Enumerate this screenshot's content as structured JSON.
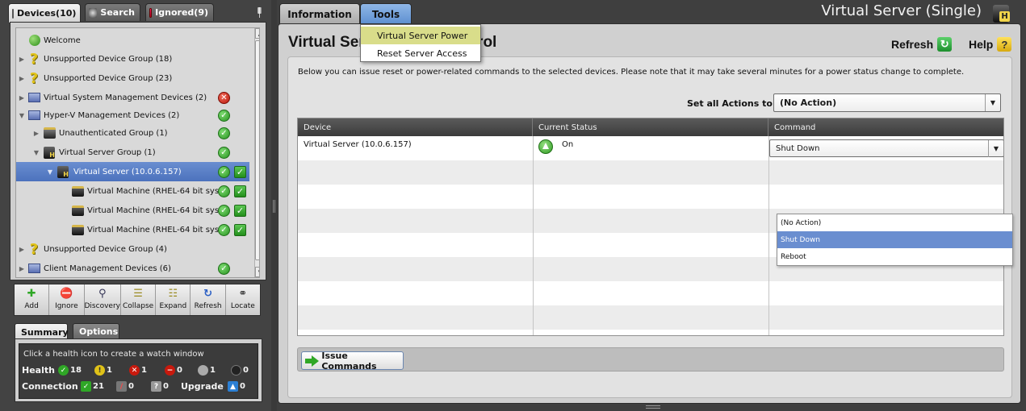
{
  "left_tabs": [
    {
      "label": "Devices(10)"
    },
    {
      "label": "Search"
    },
    {
      "label": "Ignored(9)"
    }
  ],
  "tree": {
    "items": [
      {
        "label": "Welcome",
        "icon": "globe-icon"
      },
      {
        "label": "Unsupported Device Group (18)",
        "icon": "question-icon"
      },
      {
        "label": "Unsupported Device Group (23)",
        "icon": "question-icon"
      },
      {
        "label": "Virtual System Management Devices (2)",
        "icon": "network-group-icon",
        "status": "error"
      },
      {
        "label": "Hyper-V Management Devices (2)",
        "icon": "network-group-icon",
        "status": "ok"
      },
      {
        "label": "Unauthenticated Group (1)",
        "icon": "locked-server-icon",
        "status": "ok"
      },
      {
        "label": "Virtual Server Group (1)",
        "icon": "server-h-icon",
        "status": "ok"
      },
      {
        "label": "Virtual Server (10.0.6.157)",
        "icon": "server-h-icon",
        "status": "ok",
        "checked": true
      },
      {
        "label": "Virtual Machine (RHEL-64 bit sys",
        "icon": "vm-icon",
        "status": "ok",
        "checked": true
      },
      {
        "label": "Virtual Machine (RHEL-64 bit sys",
        "icon": "vm-icon",
        "status": "ok",
        "checked": true
      },
      {
        "label": "Virtual Machine (RHEL-64 bit sys",
        "icon": "vm-icon",
        "status": "ok",
        "checked": true
      },
      {
        "label": "Unsupported Device Group (4)",
        "icon": "question-icon"
      },
      {
        "label": "Client Management Devices (6)",
        "icon": "network-group-icon",
        "status": "ok"
      }
    ]
  },
  "toolbar": {
    "buttons": [
      {
        "label": "Add",
        "icon": "add-icon"
      },
      {
        "label": "Ignore",
        "icon": "ignore-icon"
      },
      {
        "label": "Discovery",
        "icon": "discovery-icon"
      },
      {
        "label": "Collapse",
        "icon": "collapse-icon"
      },
      {
        "label": "Expand",
        "icon": "expand-icon"
      },
      {
        "label": "Refresh",
        "icon": "refresh-icon"
      },
      {
        "label": "Locate",
        "icon": "locate-icon"
      }
    ]
  },
  "summary": {
    "tabs": [
      {
        "label": "Summary"
      },
      {
        "label": "Options"
      }
    ],
    "hint": "Click a health icon to create a watch window",
    "health_label": "Health",
    "health": {
      "ok": "18",
      "warning": "1",
      "critical": "1",
      "error": "0",
      "unknown": "1",
      "off": "0"
    },
    "connection_label": "Connection",
    "connection": {
      "connected": "21",
      "disconnected": "0",
      "unknown": "0"
    },
    "upgrade_label": "Upgrade",
    "upgrade": "0"
  },
  "right_tabs": [
    {
      "label": "Information"
    },
    {
      "label": "Tools"
    }
  ],
  "tools_menu": {
    "items": [
      {
        "label": "Virtual Server Power",
        "highlighted": true
      },
      {
        "label": "Reset Server Access"
      }
    ]
  },
  "window_title": "Virtual Server (Single)",
  "page": {
    "title": "Virtual Server Power Control",
    "refresh_label": "Refresh",
    "help_label": "Help",
    "description": "Below you can issue reset or power-related commands to the selected devices.  Please note that it may take several minutes for a power status change to complete.",
    "set_all_label": "Set all Actions to:",
    "set_all_value": "(No Action)"
  },
  "grid": {
    "columns": [
      "Device",
      "Current Status",
      "Command"
    ],
    "rows": [
      {
        "device": "Virtual Server (10.0.6.157)",
        "status": "On",
        "command": "Shut Down"
      }
    ],
    "command_options": [
      "(No Action)",
      "Shut Down",
      "Reboot"
    ],
    "highlighted_option": "Shut Down"
  },
  "actions": {
    "issue_label": "Issue Commands"
  },
  "colors": {
    "selection": "#5478c2",
    "menu_highlight": "#d9dd8a",
    "ok": "#2fa726",
    "error": "#c8190d"
  }
}
